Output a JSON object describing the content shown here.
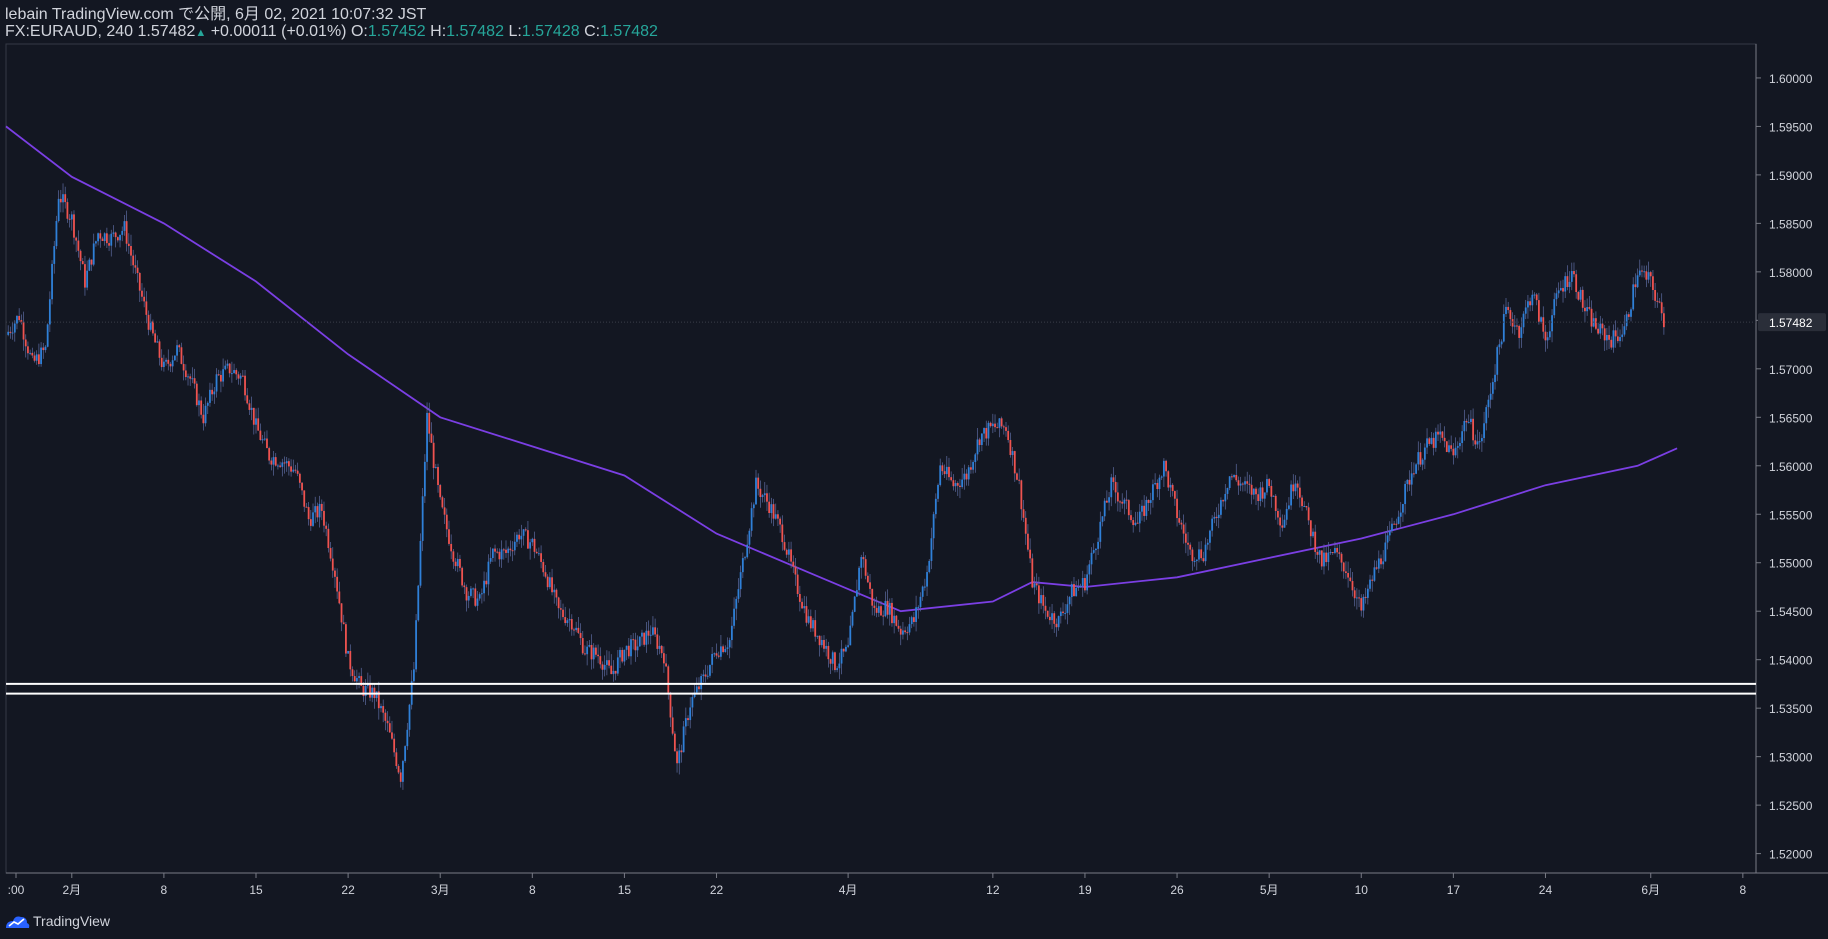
{
  "header": {
    "publisher": "lebain",
    "published_text": "TradingView.com で公開, 6月 02, 2021 10:07:32 JST",
    "symbol": "FX:EURAUD, 240",
    "last": "1.57482",
    "change_arrow": "▲",
    "change": "+0.00011 (+0.01%)",
    "o_label": "O:",
    "o": "1.57452",
    "h_label": "H:",
    "h": "1.57482",
    "l_label": "L:",
    "l": "1.57428",
    "c_label": "C:",
    "c": "1.57482"
  },
  "footer": {
    "brand": "TradingView",
    "logo_icon": "tradingview-logo-icon"
  },
  "colors": {
    "background": "#131722",
    "up_candle": "#2f80d8",
    "down_candle": "#ef5350",
    "moving_average": "#7b3fe4",
    "support_lines": "#ffffff",
    "axis_text": "#d1d4dc",
    "last_price_bg": "#2a2e39"
  },
  "chart_data": {
    "type": "candlestick",
    "timeframe": "240",
    "y_axis": {
      "ticks": [
        "1.52000",
        "1.52500",
        "1.53000",
        "1.53500",
        "1.54000",
        "1.54500",
        "1.55000",
        "1.55500",
        "1.56000",
        "1.56500",
        "1.57000",
        "1.57500",
        "1.58000",
        "1.58500",
        "1.59000",
        "1.59500",
        "1.60000"
      ],
      "last_price_label": "1.57482",
      "ylim": [
        1.518,
        1.6035
      ]
    },
    "x_axis": {
      "ticks": [
        ":00",
        "2月",
        "8",
        "15",
        "22",
        "3月",
        "8",
        "15",
        "22",
        "4月",
        "12",
        "19",
        "26",
        "5月",
        "10",
        "17",
        "24",
        "6月",
        "8"
      ],
      "xlim": [
        "2021-01-27",
        "2021-06-09"
      ]
    },
    "horizontal_lines": [
      1.5375,
      1.5365
    ],
    "close_path": [
      [
        "2021-01-27",
        1.5735
      ],
      [
        "2021-01-28",
        1.5755
      ],
      [
        "2021-01-29",
        1.5705
      ],
      [
        "2021-01-30",
        1.572
      ],
      [
        "2021-01-31",
        1.588
      ],
      [
        "2021-02-01",
        1.5855
      ],
      [
        "2021-02-02",
        1.579
      ],
      [
        "2021-02-03",
        1.584
      ],
      [
        "2021-02-04",
        1.5835
      ],
      [
        "2021-02-05",
        1.5845
      ],
      [
        "2021-02-06",
        1.579
      ],
      [
        "2021-02-07",
        1.574
      ],
      [
        "2021-02-08",
        1.57
      ],
      [
        "2021-02-09",
        1.572
      ],
      [
        "2021-02-10",
        1.569
      ],
      [
        "2021-02-11",
        1.565
      ],
      [
        "2021-02-12",
        1.569
      ],
      [
        "2021-02-13",
        1.57
      ],
      [
        "2021-02-14",
        1.569
      ],
      [
        "2021-02-15",
        1.564
      ],
      [
        "2021-02-16",
        1.561
      ],
      [
        "2021-02-17",
        1.5605
      ],
      [
        "2021-02-18",
        1.5595
      ],
      [
        "2021-02-19",
        1.5545
      ],
      [
        "2021-02-20",
        1.5555
      ],
      [
        "2021-02-21",
        1.549
      ],
      [
        "2021-02-22",
        1.54
      ],
      [
        "2021-02-23",
        1.537
      ],
      [
        "2021-02-24",
        1.5365
      ],
      [
        "2021-02-25",
        1.533
      ],
      [
        "2021-02-26",
        1.528
      ],
      [
        "2021-02-27",
        1.539
      ],
      [
        "2021-02-28",
        1.565
      ],
      [
        "2021-03-01",
        1.556
      ],
      [
        "2021-03-02",
        1.551
      ],
      [
        "2021-03-03",
        1.547
      ],
      [
        "2021-03-04",
        1.546
      ],
      [
        "2021-03-05",
        1.551
      ],
      [
        "2021-03-06",
        1.551
      ],
      [
        "2021-03-07",
        1.553
      ],
      [
        "2021-03-08",
        1.552
      ],
      [
        "2021-03-09",
        1.549
      ],
      [
        "2021-03-10",
        1.545
      ],
      [
        "2021-03-11",
        1.544
      ],
      [
        "2021-03-12",
        1.541
      ],
      [
        "2021-03-13",
        1.5405
      ],
      [
        "2021-03-14",
        1.5385
      ],
      [
        "2021-03-15",
        1.541
      ],
      [
        "2021-03-16",
        1.5415
      ],
      [
        "2021-03-17",
        1.543
      ],
      [
        "2021-03-18",
        1.5405
      ],
      [
        "2021-03-19",
        1.529
      ],
      [
        "2021-03-20",
        1.5355
      ],
      [
        "2021-03-21",
        1.538
      ],
      [
        "2021-03-22",
        1.541
      ],
      [
        "2021-03-23",
        1.542
      ],
      [
        "2021-03-24",
        1.55
      ],
      [
        "2021-03-25",
        1.558
      ],
      [
        "2021-03-26",
        1.556
      ],
      [
        "2021-03-27",
        1.553
      ],
      [
        "2021-03-28",
        1.548
      ],
      [
        "2021-03-29",
        1.544
      ],
      [
        "2021-03-30",
        1.542
      ],
      [
        "2021-03-31",
        1.5395
      ],
      [
        "2021-04-01",
        1.541
      ],
      [
        "2021-04-02",
        1.551
      ],
      [
        "2021-04-03",
        1.545
      ],
      [
        "2021-04-04",
        1.5455
      ],
      [
        "2021-04-05",
        1.543
      ],
      [
        "2021-04-06",
        1.544
      ],
      [
        "2021-04-07",
        1.549
      ],
      [
        "2021-04-08",
        1.56
      ],
      [
        "2021-04-09",
        1.558
      ],
      [
        "2021-04-10",
        1.559
      ],
      [
        "2021-04-11",
        1.563
      ],
      [
        "2021-04-12",
        1.564
      ],
      [
        "2021-04-13",
        1.564
      ],
      [
        "2021-04-14",
        1.558
      ],
      [
        "2021-04-15",
        1.548
      ],
      [
        "2021-04-16",
        1.545
      ],
      [
        "2021-04-17",
        1.544
      ],
      [
        "2021-04-18",
        1.547
      ],
      [
        "2021-04-19",
        1.548
      ],
      [
        "2021-04-20",
        1.553
      ],
      [
        "2021-04-21",
        1.558
      ],
      [
        "2021-04-22",
        1.556
      ],
      [
        "2021-04-23",
        1.554
      ],
      [
        "2021-04-24",
        1.557
      ],
      [
        "2021-04-25",
        1.56
      ],
      [
        "2021-04-26",
        1.555
      ],
      [
        "2021-04-27",
        1.551
      ],
      [
        "2021-04-28",
        1.551
      ],
      [
        "2021-04-29",
        1.555
      ],
      [
        "2021-04-30",
        1.559
      ],
      [
        "2021-05-01",
        1.558
      ],
      [
        "2021-05-02",
        1.557
      ],
      [
        "2021-05-03",
        1.558
      ],
      [
        "2021-05-04",
        1.554
      ],
      [
        "2021-05-05",
        1.559
      ],
      [
        "2021-05-06",
        1.554
      ],
      [
        "2021-05-07",
        1.55
      ],
      [
        "2021-05-08",
        1.551
      ],
      [
        "2021-05-09",
        1.549
      ],
      [
        "2021-05-10",
        1.545
      ],
      [
        "2021-05-11",
        1.549
      ],
      [
        "2021-05-12",
        1.552
      ],
      [
        "2021-05-13",
        1.556
      ],
      [
        "2021-05-14",
        1.56
      ],
      [
        "2021-05-15",
        1.562
      ],
      [
        "2021-05-16",
        1.563
      ],
      [
        "2021-05-17",
        1.561
      ],
      [
        "2021-05-18",
        1.565
      ],
      [
        "2021-05-19",
        1.562
      ],
      [
        "2021-05-20",
        1.569
      ],
      [
        "2021-05-21",
        1.576
      ],
      [
        "2021-05-22",
        1.574
      ],
      [
        "2021-05-23",
        1.578
      ],
      [
        "2021-05-24",
        1.573
      ],
      [
        "2021-05-25",
        1.578
      ],
      [
        "2021-05-26",
        1.58
      ],
      [
        "2021-05-27",
        1.576
      ],
      [
        "2021-05-28",
        1.574
      ],
      [
        "2021-05-29",
        1.573
      ],
      [
        "2021-05-30",
        1.574
      ],
      [
        "2021-05-31",
        1.58
      ],
      [
        "2021-06-01",
        1.579
      ],
      [
        "2021-06-02",
        1.5748
      ]
    ],
    "moving_average": {
      "points": [
        [
          "2021-01-27",
          1.595
        ],
        [
          "2021-02-01",
          1.5898
        ],
        [
          "2021-02-08",
          1.585
        ],
        [
          "2021-02-15",
          1.579
        ],
        [
          "2021-02-22",
          1.5715
        ],
        [
          "2021-03-01",
          1.565
        ],
        [
          "2021-03-08",
          1.562
        ],
        [
          "2021-03-15",
          1.559
        ],
        [
          "2021-03-22",
          1.553
        ],
        [
          "2021-03-29",
          1.549
        ],
        [
          "2021-04-05",
          1.545
        ],
        [
          "2021-04-12",
          1.546
        ],
        [
          "2021-04-15",
          1.548
        ],
        [
          "2021-04-19",
          1.5475
        ],
        [
          "2021-04-26",
          1.5485
        ],
        [
          "2021-05-03",
          1.5505
        ],
        [
          "2021-05-10",
          1.5525
        ],
        [
          "2021-05-17",
          1.555
        ],
        [
          "2021-05-24",
          1.558
        ],
        [
          "2021-05-31",
          1.56
        ],
        [
          "2021-06-03",
          1.5618
        ]
      ]
    }
  }
}
